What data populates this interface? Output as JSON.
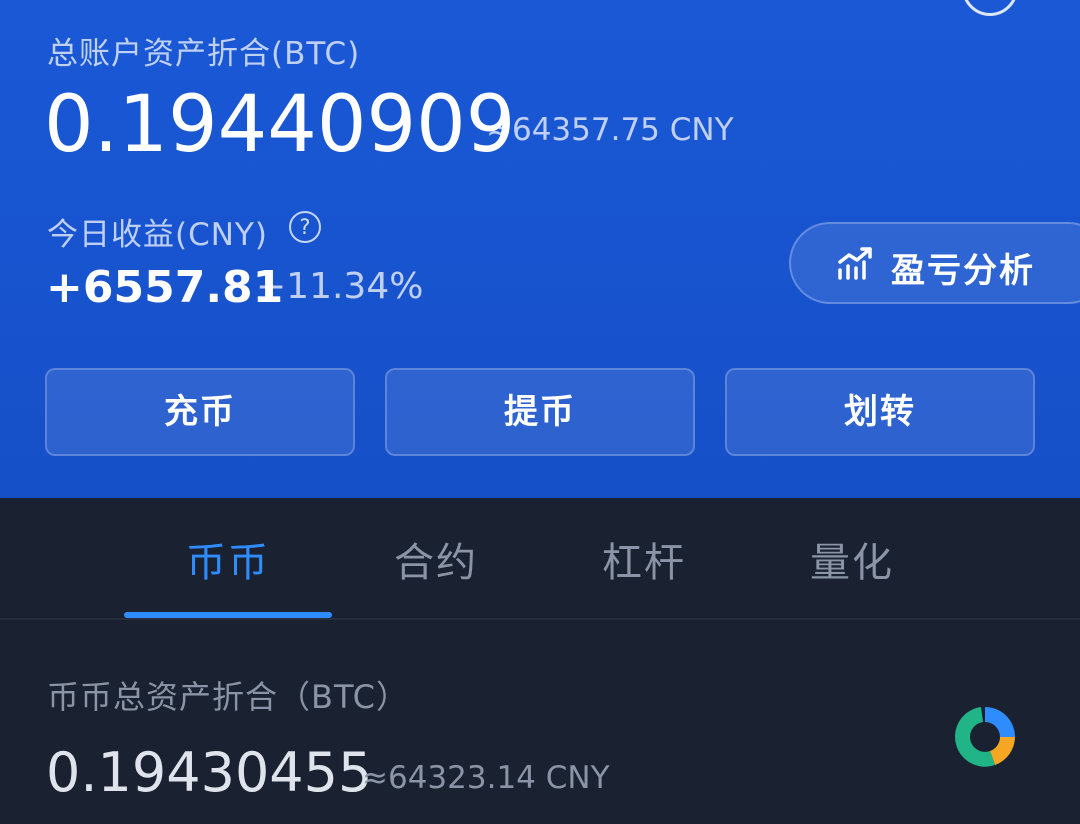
{
  "header": {
    "total_label": "总账户资产折合(BTC)",
    "total_value": "0.19440909",
    "total_approx": "≈64357.75 CNY",
    "today_label": "今日收益(CNY)",
    "help_icon": "?",
    "today_value": "+6557.81",
    "today_percent": "+11.34%",
    "pnl_button_label": "盈亏分析",
    "pnl_icon": "chart-line-icon"
  },
  "actions": {
    "deposit": "充币",
    "withdraw": "提币",
    "transfer": "划转"
  },
  "tabs": [
    {
      "label": "币币",
      "active": true
    },
    {
      "label": "合约",
      "active": false
    },
    {
      "label": "杠杆",
      "active": false
    },
    {
      "label": "量化",
      "active": false
    }
  ],
  "spot": {
    "label": "币币总资产折合（BTC）",
    "value": "0.19430455",
    "approx": "≈64323.14 CNY",
    "allocation_icon": "donut-chart-icon"
  },
  "colors": {
    "header_blue": "#1a58d6",
    "page_dark": "#1a2130",
    "accent_blue": "#2f8cff",
    "muted_text": "#8a94a6"
  }
}
